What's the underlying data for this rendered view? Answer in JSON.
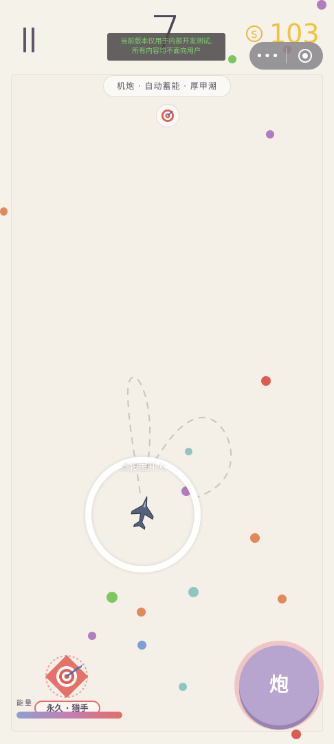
{
  "hud": {
    "score": "7",
    "coin_symbol": "S",
    "coin_count": "103",
    "notice_line1": "当前版本仅用于内部开发测试,",
    "notice_line2": "所有内容均不面向用户",
    "capsule_more": "•••",
    "status_text": "机炮 · 自动蓄能 · 厚甲潮"
  },
  "control": {
    "tap_hint": "点按击开火"
  },
  "ability": {
    "energy_label": "能量",
    "name": "永久 · 猎手",
    "energy_fraction": 1.0
  },
  "fire_button": {
    "label": "炮"
  },
  "colors": {
    "coin": "#ecb83b",
    "fire": "#b7a5cf",
    "accent_red": "#e36d68"
  },
  "icons": {
    "pause": "pause-icon",
    "coin": "coin-icon",
    "target": "target-icon",
    "ship": "jet-fighter-icon",
    "close": "capsule-close-icon"
  }
}
